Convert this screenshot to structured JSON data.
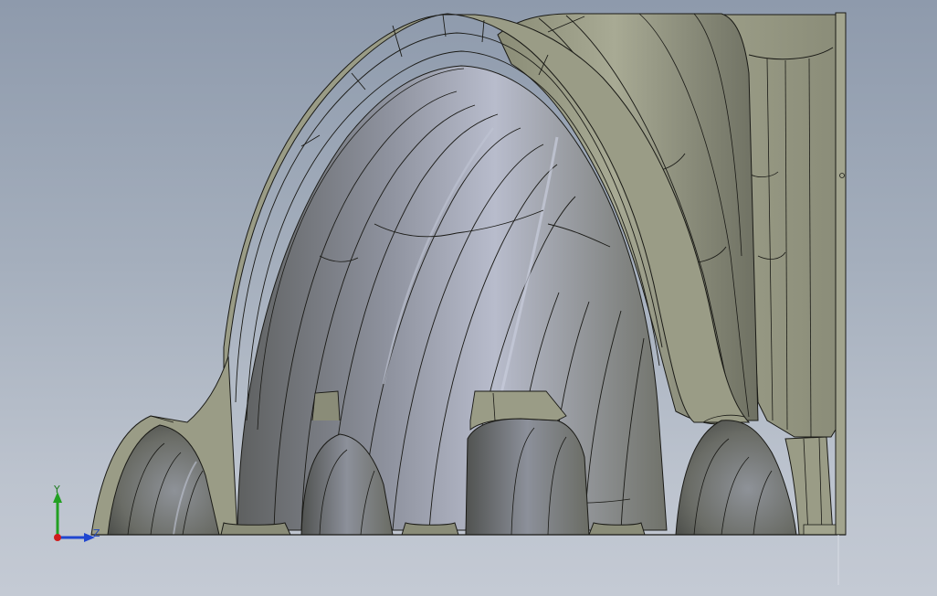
{
  "viewport": {
    "background_top": "#8e9aac",
    "background_bottom": "#c4cad4"
  },
  "model": {
    "face_color": "#9a9c86",
    "edge_color": "#1a1a16",
    "highlight_color": "#b2b6c8",
    "shadow_color": "#5e6052"
  },
  "triad": {
    "y_label": "Y",
    "z_label": "Z",
    "y_color": "#22a022",
    "z_color": "#2046d0",
    "origin_color": "#d01c1c"
  }
}
